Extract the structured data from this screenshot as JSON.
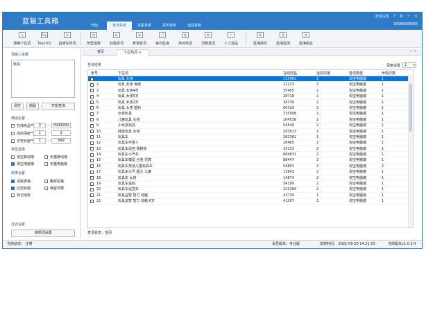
{
  "app": {
    "title": "蓝猫工具箱",
    "menus": [
      {
        "label": "开始"
      },
      {
        "label": "查询系统"
      },
      {
        "label": "采集系统"
      },
      {
        "label": "发布系统"
      },
      {
        "label": "运营系统"
      }
    ],
    "window": {
      "skin_label": "皮肤设置",
      "help_icon": "?",
      "settings_icon": "⚙",
      "minimize_icon": "─",
      "close_icon": "✕"
    },
    "user": "18088888888"
  },
  "toolbar": [
    {
      "label": "搜索下拉词",
      "icon": "search-dropdown-icon",
      "glyph": "🔍"
    },
    {
      "label": "Top20万",
      "icon": "top-icon",
      "glyph": "Top"
    },
    {
      "label": "直通车热词",
      "icon": "hot-words-icon",
      "glyph": "车"
    },
    {
      "label": "阿里指数",
      "icon": "index-icon",
      "glyph": "指"
    },
    {
      "label": "标题拆词",
      "icon": "split-title-icon",
      "glyph": "拆"
    },
    {
      "label": "参谋查词",
      "icon": "advisor-icon",
      "glyph": "参"
    },
    {
      "label": "每日蓝海",
      "icon": "daily-blue-ocean-icon",
      "glyph": "日"
    },
    {
      "label": "类目热词",
      "icon": "category-hot-icon",
      "glyph": "类"
    },
    {
      "label": "词根查词",
      "icon": "root-word-icon",
      "glyph": "根"
    },
    {
      "label": "人工选品",
      "icon": "manual-select-icon",
      "glyph": "人"
    },
    {
      "label": "蓝海探究",
      "icon": "blue-ocean-explore-icon",
      "glyph": "探"
    },
    {
      "label": "蓝海监测",
      "icon": "blue-ocean-monitor-icon",
      "glyph": "监"
    },
    {
      "label": "蓝海组合",
      "icon": "blue-ocean-combo-icon",
      "glyph": "组"
    }
  ],
  "left": {
    "keyword_section": "请输入关键",
    "keyword_value": "玩具",
    "buttons": {
      "clear": "清空",
      "paste": "粘贴",
      "start": "开始查询"
    },
    "filter_section": "筛选设置",
    "filters": [
      {
        "label": "在线商品",
        "min": "0",
        "max": "9999999",
        "checked": false
      },
      {
        "label": "当前深度",
        "min": "1",
        "max": "3",
        "checked": false
      },
      {
        "label": "字符长度",
        "min": "1",
        "max": "999",
        "checked": false
      }
    ],
    "type_section": "类型选择",
    "types": [
      {
        "label": "淘宝移动端",
        "checked": false
      },
      {
        "label": "天猫移动端",
        "checked": false
      },
      {
        "label": "淘宝电脑端",
        "checked": true
      },
      {
        "label": "天猫电脑端",
        "checked": false
      }
    ],
    "result_section": "结果设置",
    "results": [
      {
        "label": "清除表格",
        "checked": true
      },
      {
        "label": "删除空格",
        "checked": false
      },
      {
        "label": "过滤标题",
        "checked": true
      },
      {
        "label": "保留词根",
        "checked": false
      },
      {
        "label": "标记违规",
        "checked": false
      }
    ],
    "filter_words_section": "过滤设置",
    "filter_words_button": "违规词设置"
  },
  "tabs": [
    {
      "label": "首页"
    },
    {
      "label": "下拉热词",
      "close": "×"
    }
  ],
  "tabnav": "‹  ›  ▾",
  "main": {
    "result_title": "查询结果",
    "depth_label": "深度设置",
    "depth_value": "2",
    "columns": [
      "序号",
      "下拉词",
      "在线商品",
      "当前深度",
      "查词类型",
      "出现次数"
    ],
    "rows": [
      {
        "no": "",
        "word": "玩具 女孩",
        "online": "123961",
        "depth": "1",
        "type": "淘宝电脑端",
        "count": "1",
        "selected": true
      },
      {
        "no": "2",
        "word": "玩具 女孩 海澈",
        "online": "21213",
        "depth": "2",
        "type": "淘宝电脑端",
        "count": "1"
      },
      {
        "no": "3",
        "word": "玩具 女孩4岁",
        "online": "35465",
        "depth": "2",
        "type": "淘宝电脑端",
        "count": "1"
      },
      {
        "no": "4",
        "word": "玩具 女孩5岁",
        "online": "28718",
        "depth": "2",
        "type": "淘宝电脑端",
        "count": "1"
      },
      {
        "no": "5",
        "word": "玩具 女孩2岁",
        "online": "34739",
        "depth": "2",
        "type": "淘宝电脑端",
        "count": "1"
      },
      {
        "no": "6",
        "word": "玩具 女孩 塑料",
        "online": "60725",
        "depth": "2",
        "type": "淘宝电脑端",
        "count": "1"
      },
      {
        "no": "7",
        "word": "女孩玩具",
        "online": "135998",
        "depth": "2",
        "type": "淘宝电脑端",
        "count": "1"
      },
      {
        "no": "8",
        "word": "儿童玩具 女孩",
        "online": "104538",
        "depth": "2",
        "type": "淘宝电脑端",
        "count": "1"
      },
      {
        "no": "9",
        "word": "小女孩玩具",
        "online": "54549",
        "depth": "2",
        "type": "淘宝电脑端",
        "count": "1"
      },
      {
        "no": "10",
        "word": "娃娃玩具 女孩",
        "online": "293813",
        "depth": "2",
        "type": "淘宝电脑端",
        "count": "1"
      },
      {
        "no": "11",
        "word": "玩具车",
        "online": "282381",
        "depth": "1",
        "type": "淘宝电脑端",
        "count": "1"
      },
      {
        "no": "12",
        "word": "玩具车可坐人",
        "online": "26465",
        "depth": "2",
        "type": "淘宝电脑端",
        "count": "1"
      },
      {
        "no": "13",
        "word": "玩具车遥控 赛跑车",
        "online": "19133",
        "depth": "2",
        "type": "淘宝电脑端",
        "count": "1"
      },
      {
        "no": "14",
        "word": "玩具车小汽车",
        "online": "884831",
        "depth": "2",
        "type": "淘宝电脑端",
        "count": "1"
      },
      {
        "no": "15",
        "word": "玩具车模型 合金 仿真",
        "online": "88447",
        "depth": "2",
        "type": "淘宝电脑端",
        "count": "1"
      },
      {
        "no": "16",
        "word": "玩具车男孩儿童玩具车",
        "online": "54891",
        "depth": "2",
        "type": "淘宝电脑端",
        "count": "2"
      },
      {
        "no": "17",
        "word": "玩具车大号 超大 儿童",
        "online": "13843",
        "depth": "2",
        "type": "淘宝电脑端",
        "count": "1"
      },
      {
        "no": "18",
        "word": "玩具车 女孩",
        "online": "14874",
        "depth": "2",
        "type": "淘宝电脑端",
        "count": "1"
      },
      {
        "no": "19",
        "word": "玩具车遥控",
        "online": "54199",
        "depth": "2",
        "type": "淘宝电脑端",
        "count": "1"
      },
      {
        "no": "20",
        "word": "玩具车遥控车",
        "online": "124284",
        "depth": "2",
        "type": "淘宝电脑端",
        "count": "1"
      },
      {
        "no": "21",
        "word": "玩具益智 智力 动脑",
        "online": "43730",
        "depth": "1",
        "type": "淘宝电脑端",
        "count": "1"
      },
      {
        "no": "22",
        "word": "玩具益智 智力 动脑 6岁",
        "online": "41287",
        "depth": "2",
        "type": "淘宝电脑端",
        "count": "1"
      }
    ],
    "query_status": "查词状态：空闲"
  },
  "statusbar": {
    "status": "当前状态： 正常",
    "member": "会员版本：专业版",
    "expires": "授权时间： 2021-09-20 14:21:53",
    "version": "当前版本v1.0.3.4"
  },
  "colors": {
    "brand": "#2f7bc8",
    "selected_row": "#0a75d9"
  }
}
